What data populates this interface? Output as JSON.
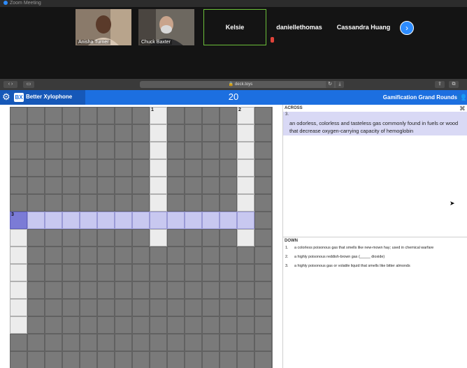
{
  "window": {
    "title": "Zoom Meeting"
  },
  "participants": [
    {
      "name": "Anisha Turner",
      "type": "video"
    },
    {
      "name": "Chuck Baxter",
      "type": "video"
    },
    {
      "name": "Kelsie",
      "type": "name",
      "active": true
    },
    {
      "name": "daniellethomas",
      "type": "name"
    },
    {
      "name": "Cassandra Huang",
      "type": "name"
    }
  ],
  "browser": {
    "url": "deck.toys"
  },
  "app": {
    "logo": "BX",
    "team_name": "Better Xylophone",
    "score": "20",
    "game_name": "Gamification Grand Rounds"
  },
  "crossword": {
    "across_heading": "ACROSS",
    "active_clue": {
      "number": "3.",
      "text": "an odorless, colorless and tasteless gas commonly found in fuels or wood that decrease oxygen-carrying capacity of hemoglobin"
    },
    "down_heading": "DOWN",
    "down_clues": [
      {
        "number": "1.",
        "text": "a colorless poisonous gas that smells like new-mown hay; used in chemical warfare"
      },
      {
        "number": "2.",
        "text": "a highly poisonous reddish-brown gas (_____ dioxide)"
      },
      {
        "number": "3.",
        "text": "a highly poisonous gas or volatile liquid that smells like bitter almonds"
      }
    ],
    "cell_numbers": {
      "n1": "1",
      "n2": "2",
      "n3": "3"
    }
  },
  "icons": {
    "gear": "gear-icon",
    "people": "people-icon",
    "close": "close-icon",
    "next": "chevron-right-icon"
  },
  "colors": {
    "app_bar": "#1c6fe0",
    "highlight": "#c8c8f0",
    "selected": "#7b7bd6"
  }
}
